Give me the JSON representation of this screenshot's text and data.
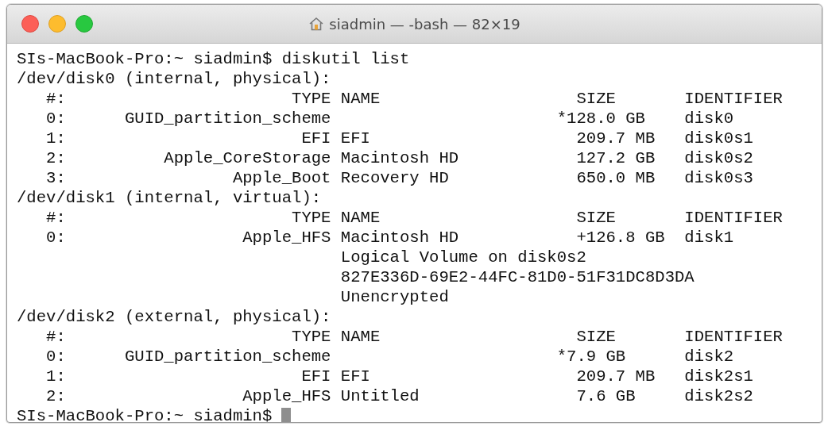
{
  "window": {
    "title": "siadmin — -bash — 82×19"
  },
  "lines": [
    "SIs-MacBook-Pro:~ siadmin$ diskutil list",
    "/dev/disk0 (internal, physical):",
    "   #:                       TYPE NAME                    SIZE       IDENTIFIER",
    "   0:      GUID_partition_scheme                       *128.0 GB    disk0",
    "   1:                        EFI EFI                     209.7 MB   disk0s1",
    "   2:          Apple_CoreStorage Macintosh HD            127.2 GB   disk0s2",
    "   3:                 Apple_Boot Recovery HD             650.0 MB   disk0s3",
    "/dev/disk1 (internal, virtual):",
    "   #:                       TYPE NAME                    SIZE       IDENTIFIER",
    "   0:                  Apple_HFS Macintosh HD            +126.8 GB  disk1",
    "                                 Logical Volume on disk0s2",
    "                                 827E336D-69E2-44FC-81D0-51F31DC8D3DA",
    "                                 Unencrypted",
    "/dev/disk2 (external, physical):",
    "   #:                       TYPE NAME                    SIZE       IDENTIFIER",
    "   0:      GUID_partition_scheme                       *7.9 GB      disk2",
    "   1:                        EFI EFI                     209.7 MB   disk2s1",
    "   2:                  Apple_HFS Untitled                7.6 GB     disk2s2"
  ],
  "prompt": "SIs-MacBook-Pro:~ siadmin$"
}
